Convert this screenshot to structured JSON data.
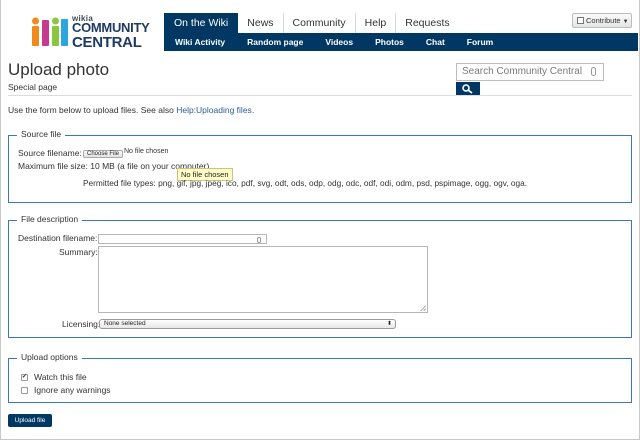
{
  "logo": {
    "wikia": "wikia",
    "line1": "COMMUNITY",
    "line2": "CENTRAL"
  },
  "colors": {
    "nav_bg": "#003863",
    "accent_link": "#2a5d94",
    "fieldset_border": "#3b78b5"
  },
  "topnav": {
    "tabs": [
      "On the Wiki",
      "News",
      "Community",
      "Help",
      "Requests"
    ],
    "active": "On the Wiki"
  },
  "subnav": {
    "items": [
      "Wiki Activity",
      "Random page",
      "Videos",
      "Photos",
      "Chat",
      "Forum"
    ]
  },
  "contribute": {
    "label": "Contribute",
    "icon": "pencil-icon"
  },
  "page": {
    "title": "Upload photo",
    "subtitle": "Special page"
  },
  "search": {
    "placeholder": "Search Community Central",
    "button_icon": "search-icon"
  },
  "intro": {
    "text": "Use the form below to upload files. See also ",
    "link": "Help:Uploading files",
    "suffix": "."
  },
  "source": {
    "legend": "Source file",
    "filename_label": "Source filename:",
    "choose_button": "Choose File",
    "no_file": "No file chosen",
    "max_size": "Maximum file size: 10 MB (a file on your computer)",
    "tooltip": "No file chosen",
    "permitted": "Permitted file types: png, gif, jpg, jpeg, ico, pdf, svg, odt, ods, odp, odg, odc, odf, odi, odm, psd, pspimage, ogg, ogv, oga."
  },
  "description": {
    "legend": "File description",
    "dest_label": "Destination filename:",
    "dest_value": "",
    "summary_label": "Summary:",
    "summary_value": "",
    "licensing_label": "Licensing:",
    "licensing_selected": "None selected"
  },
  "options": {
    "legend": "Upload options",
    "watch_label": "Watch this file",
    "watch_checked": true,
    "ignore_label": "Ignore any warnings",
    "ignore_checked": false
  },
  "upload_button": "Upload file"
}
